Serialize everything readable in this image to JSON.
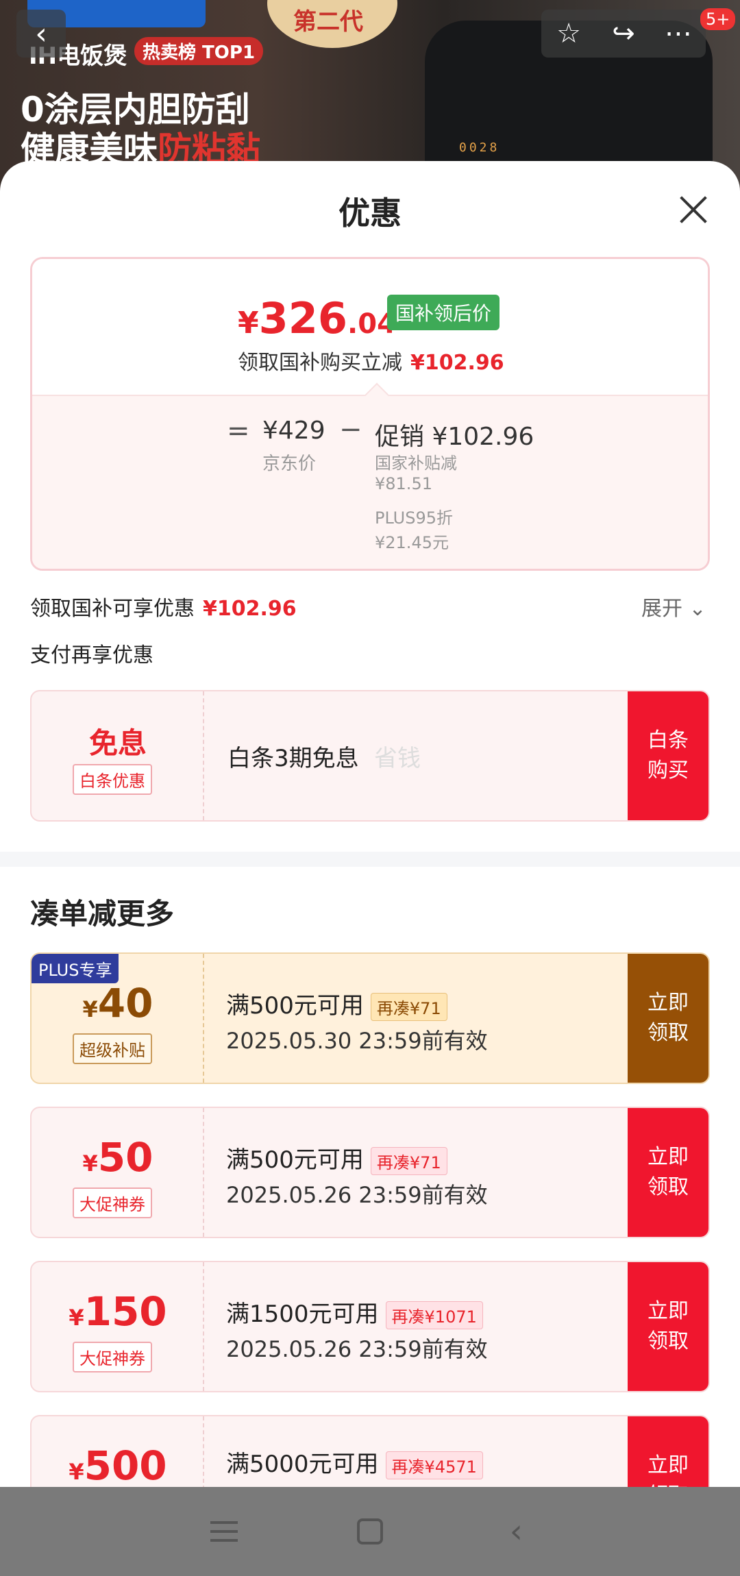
{
  "hero": {
    "badge_text": "第二代",
    "product_tag": "IH电饭煲",
    "rank_tag": "热卖榜 TOP1",
    "line1": "0涂层内胆防刮",
    "line2_plain": "健康美味",
    "line2_red": "防粘黏",
    "device_display": "0028",
    "notification_count": "5+"
  },
  "sheet": {
    "title": "优惠"
  },
  "price_card": {
    "currency": "¥",
    "price_int": "326",
    "price_dec": ".04",
    "price_tag": "国补领后价",
    "sub_label": "领取国补购买立减",
    "sub_value": "¥102.96",
    "equals": "=",
    "jd_price": "¥429",
    "jd_label": "京东价",
    "minus": "−",
    "promo": "促销 ¥102.96",
    "sub1_label": "国家补贴减",
    "sub1_value": "¥81.51",
    "sub2_label": "PLUS95折",
    "sub2_value": "¥21.45元"
  },
  "summary": {
    "label": "领取国补可享优惠",
    "value": "¥102.96",
    "expand_label": "展开",
    "pay_label": "支付再享优惠"
  },
  "baitiao": {
    "free_label": "免息",
    "tag": "白条优惠",
    "main": "白条3期免息",
    "ghost": "省钱",
    "button": "白条购买"
  },
  "section": {
    "title": "凑单减更多"
  },
  "coupons": [
    {
      "plus_tag": "PLUS专享",
      "currency": "¥",
      "amount": "40",
      "category": "超级补贴",
      "condition": "满500元可用",
      "more": "再凑¥71",
      "date": "2025.05.30 23:59前有效",
      "button": "立即领取"
    },
    {
      "currency": "¥",
      "amount": "50",
      "category": "大促神券",
      "condition": "满500元可用",
      "more": "再凑¥71",
      "date": "2025.05.26 23:59前有效",
      "button": "立即领取"
    },
    {
      "currency": "¥",
      "amount": "150",
      "category": "大促神券",
      "condition": "满1500元可用",
      "more": "再凑¥1071",
      "date": "2025.05.26 23:59前有效",
      "button": "立即领取"
    },
    {
      "currency": "¥",
      "amount": "500",
      "condition": "满5000元可用",
      "more": "再凑¥4571",
      "button": "立即领取"
    }
  ],
  "colors": {
    "accent_red": "#e8242c",
    "button_red": "#f0162e",
    "plus_gold": "#965006",
    "tag_green": "#3eaa57",
    "plus_blue": "#2f3c9c"
  },
  "icons": {
    "back": "chevron-left-icon",
    "favorite": "star-icon",
    "share": "share-arrow-icon",
    "more": "more-dots-icon",
    "close": "close-icon",
    "expand": "chevron-down-icon",
    "nav_menu": "menu-icon",
    "nav_home": "home-square-icon",
    "nav_back": "back-icon"
  }
}
